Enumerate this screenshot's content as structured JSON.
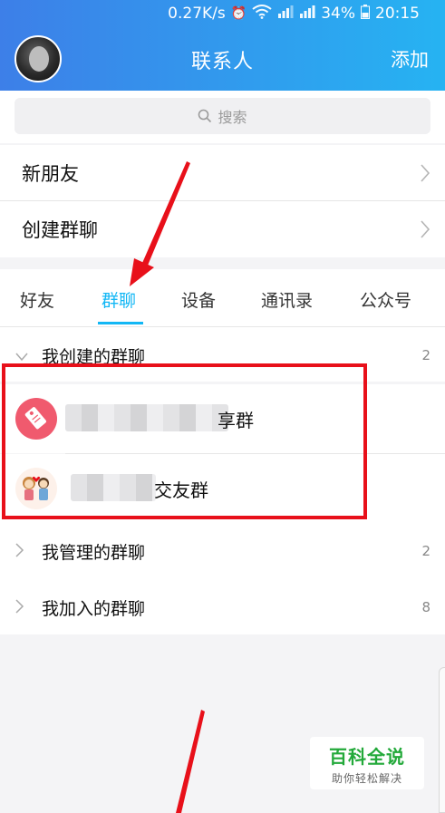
{
  "status_bar": {
    "speed": "0.27K/s",
    "battery": "34%",
    "time": "20:15"
  },
  "header": {
    "title": "联系人",
    "add_label": "添加"
  },
  "search": {
    "placeholder": "搜索"
  },
  "menu": {
    "new_friends": "新朋友",
    "create_group": "创建群聊"
  },
  "tabs": [
    {
      "label": "好友"
    },
    {
      "label": "群聊"
    },
    {
      "label": "设备"
    },
    {
      "label": "通讯录"
    },
    {
      "label": "公众号"
    }
  ],
  "active_tab": "群聊",
  "sections": {
    "created": {
      "label": "我创建的群聊",
      "count": "2"
    },
    "managed": {
      "label": "我管理的群聊",
      "count": "2"
    },
    "joined": {
      "label": "我加入的群聊",
      "count": "8"
    }
  },
  "groups": [
    {
      "name_visible": "享群"
    },
    {
      "name_visible": "交友群"
    }
  ],
  "watermark": {
    "title": "百科全说",
    "subtitle": "助你轻松解决"
  },
  "colors": {
    "accent": "#12b7f5",
    "header_start": "#3d7fe8",
    "header_end": "#26b3f2",
    "highlight": "#e8101a"
  }
}
